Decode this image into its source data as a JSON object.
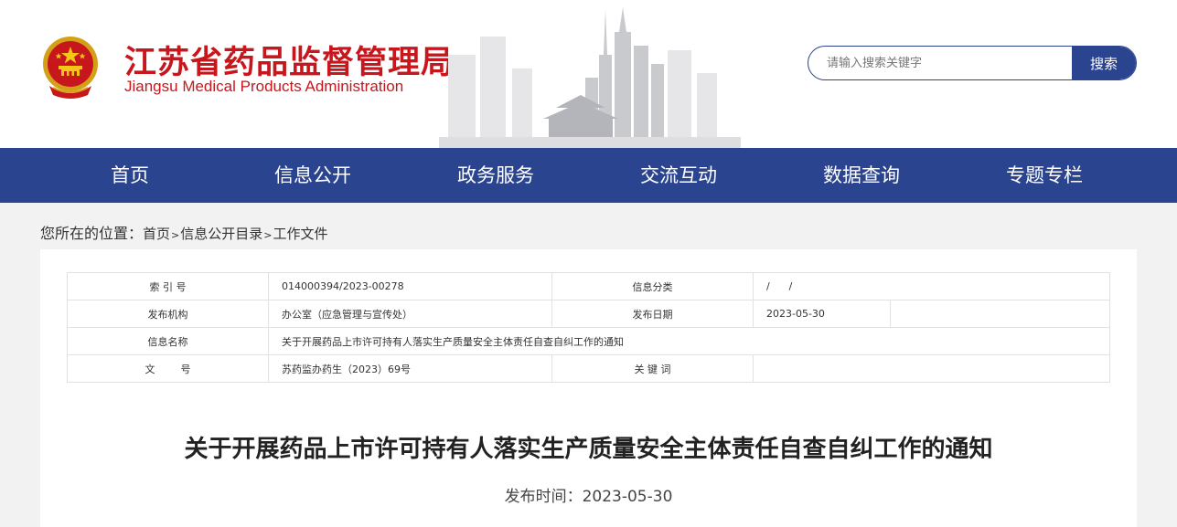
{
  "header": {
    "title": "江苏省药品监督管理局",
    "subtitle": "Jiangsu Medical Products Administration",
    "emblem_icon": "national-emblem-icon"
  },
  "search": {
    "placeholder": "请输入搜索关键字",
    "button_label": "搜索"
  },
  "nav": {
    "items": [
      {
        "label": "首页"
      },
      {
        "label": "信息公开"
      },
      {
        "label": "政务服务"
      },
      {
        "label": "交流互动"
      },
      {
        "label": "数据查询"
      },
      {
        "label": "专题专栏"
      }
    ]
  },
  "breadcrumb": {
    "prefix": "您所在的位置：",
    "items": [
      "首页",
      "信息公开目录",
      "工作文件"
    ],
    "separator": ">"
  },
  "meta_table": {
    "index_label": "索 引 号",
    "index_value": "014000394/2023-00278",
    "category_label": "信息分类",
    "category_value": "/      /",
    "publisher_label": "发布机构",
    "publisher_value": "办公室（应急管理与宣传处）",
    "date_label": "发布日期",
    "date_value": "2023-05-30",
    "name_label": "信息名称",
    "name_value": "关于开展药品上市许可持有人落实生产质量安全主体责任自查自纠工作的通知",
    "doc_label": "文        号",
    "doc_value": "苏药监办药生（2023）69号",
    "keyword_label": "关 键 词",
    "keyword_value": ""
  },
  "article": {
    "title": "关于开展药品上市许可持有人落实生产质量安全主体责任自查自纠工作的通知",
    "date": "发布时间：2023-05-30"
  },
  "colors": {
    "brand_red": "#c8161d",
    "nav_blue": "#2b4490",
    "page_bg": "#f2f2f2"
  }
}
